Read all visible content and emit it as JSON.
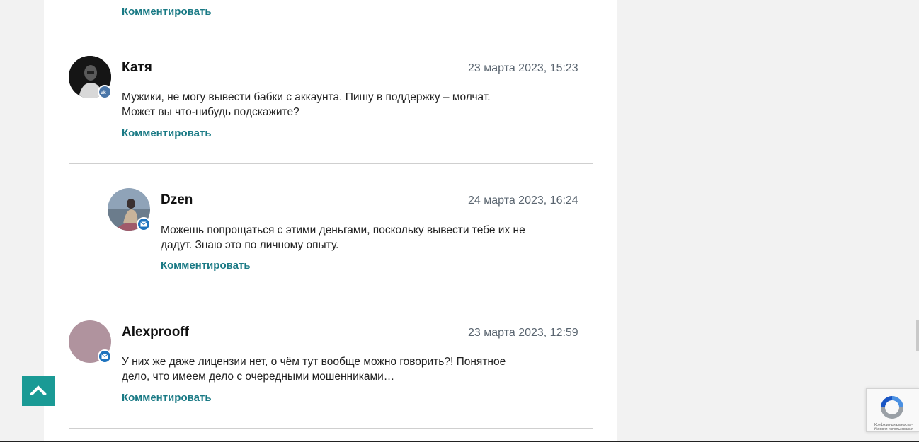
{
  "comments": [
    {
      "author": "Катя",
      "date": "23 марта 2023, 15:23",
      "text": "Мужики, не могу вывести бабки с аккаунта. Пишу в поддержку – молчат. Может вы что-нибудь подскажите?",
      "badge": "vk-icon",
      "reply_label": "Комментировать"
    },
    {
      "author": "Dzen",
      "date": "24 марта 2023, 16:24",
      "text": "Можешь попрощаться с этими деньгами, поскольку вывести тебе их не дадут. Знаю это по личному опыту.",
      "badge": "mail-icon",
      "reply_label": "Комментировать"
    },
    {
      "author": "Alexprooff",
      "date": "23 марта 2023, 12:59",
      "text": "У них же даже лицензии нет, о чём тут вообще можно говорить?! Понятное дело, что имеем дело с очередными мошенниками…",
      "badge": "mail-icon",
      "reply_label": "Комментировать"
    }
  ],
  "previous": {
    "reply_label": "Комментировать"
  },
  "colors": {
    "link": "#1a7a85",
    "scroll_top_bg": "#1a9a95",
    "vk_badge": "#4a76a8",
    "mail_badge": "#1e73be",
    "avatar_placeholder": "#b0939e"
  },
  "icons": {
    "scroll_top": "chevron-up-icon",
    "recaptcha": "recaptcha-icon"
  },
  "recaptcha": {
    "text": "Конфиденциальность - Условия использования"
  }
}
